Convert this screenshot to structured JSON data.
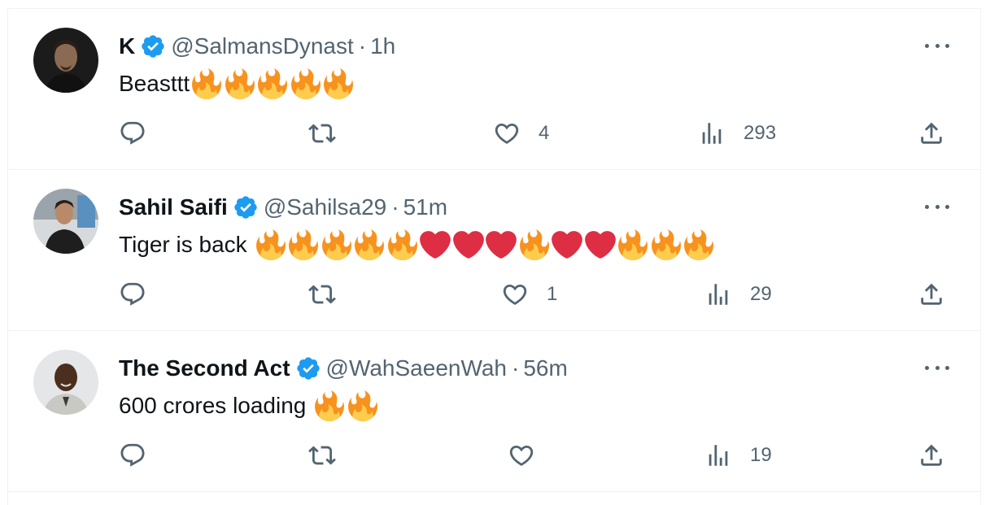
{
  "colors": {
    "text": "#0f1419",
    "muted": "#536471",
    "verified": "#1d9bf0",
    "border": "#eff3f4",
    "fire": "#f7921e",
    "heart": "#dd2e44"
  },
  "tweets": [
    {
      "name": "K",
      "verified": true,
      "handle": "@SalmansDynast",
      "separator": "·",
      "time": "1h",
      "text": "Beasttt",
      "emojis": [
        "fire",
        "fire",
        "fire",
        "fire",
        "fire"
      ],
      "emoji_gap": false,
      "reply_count": "",
      "retweet_count": "",
      "like_count": "4",
      "view_count": "293"
    },
    {
      "name": "Sahil Saifi",
      "verified": true,
      "handle": "@Sahilsa29",
      "separator": "·",
      "time": "51m",
      "text": "Tiger is back",
      "emojis": [
        "fire",
        "fire",
        "fire",
        "fire",
        "fire",
        "heart",
        "heart",
        "heart",
        "fire",
        "heart",
        "heart",
        "fire",
        "fire",
        "fire"
      ],
      "emoji_gap": true,
      "reply_count": "",
      "retweet_count": "",
      "like_count": "1",
      "view_count": "29"
    },
    {
      "name": "The Second Act",
      "verified": true,
      "handle": "@WahSaeenWah",
      "separator": "·",
      "time": "56m",
      "text": "600 crores loading",
      "emojis": [
        "fire",
        "fire"
      ],
      "emoji_gap": true,
      "reply_count": "",
      "retweet_count": "",
      "like_count": "",
      "view_count": "19"
    }
  ],
  "icons": {
    "avatar": "avatar-photo",
    "verified": "verified-badge-icon",
    "more": "more-dots-icon",
    "reply": "reply-icon",
    "retweet": "retweet-icon",
    "like": "heart-icon",
    "views": "views-icon",
    "share": "share-icon"
  }
}
